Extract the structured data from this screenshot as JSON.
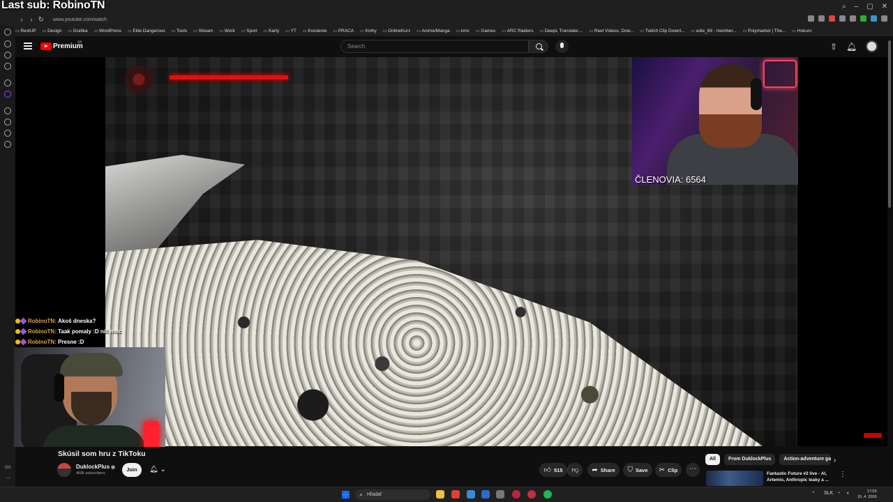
{
  "overlay": {
    "last_sub": "Last sub: RobinoTN"
  },
  "browser": {
    "url": "www.youtube.com/watch",
    "bookmarks": [
      "RestUP",
      "Design",
      "Grafika",
      "WordPress",
      "Elite Dangerous",
      "Tools",
      "Stream",
      "Work",
      "Sport",
      "Karty",
      "YT",
      "Kreslenie",
      "PRACA",
      "Knihy",
      "OnlineKurz",
      "Anime/Manga",
      "kmx",
      "Games",
      "ARC Raiders",
      "DeepL Translate:...",
      "Reel Videos, Dow...",
      "Twitch Clip Downl...",
      "edie_69 - member...",
      "Polymarket | The...",
      "Hokuro"
    ]
  },
  "header": {
    "logo_text": "Premium",
    "country": "SK",
    "search_placeholder": "Search",
    "icons": [
      "upload-icon",
      "bell-icon",
      "avatar"
    ]
  },
  "player": {
    "members_overlay": "ČLENOVIA: 6564"
  },
  "chat": [
    {
      "name": "RobinoTN:",
      "msg": "Akoš dneska?"
    },
    {
      "name": "RobinoTN:",
      "msg": "Taak pomaly :D nič moc"
    },
    {
      "name": "RobinoTN:",
      "msg": "Presne :D"
    }
  ],
  "video": {
    "title": "Skúsil som hru z TikToku",
    "channel": "DuklockPlus",
    "subscribers": "469k subscribers",
    "join_label": "Join",
    "likes": "515",
    "share_label": "Share",
    "save_label": "Save",
    "clip_label": "Clip"
  },
  "sidebar_chips": [
    "All",
    "From DuklockPlus",
    "Action-adventure game"
  ],
  "recommendation": {
    "title": "Fantastic Future #2 live - AI, Artemis, Anthropic leaky a ..."
  },
  "taskbar": {
    "search_placeholder": "Hľadať",
    "language": "SLK",
    "time": "17:03",
    "date": "15. 4. 2026"
  },
  "left_edge": {
    "label": "GX"
  }
}
